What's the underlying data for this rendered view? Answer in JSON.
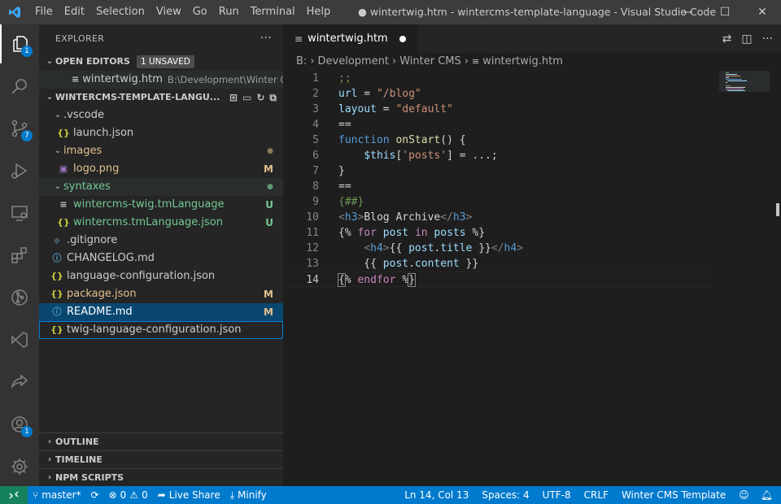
{
  "menu": [
    "File",
    "Edit",
    "Selection",
    "View",
    "Go",
    "Run",
    "Terminal",
    "Help"
  ],
  "window_title": "● wintertwig.htm - wintercms-template-language - Visual Studio Code",
  "activity_badges": {
    "explorer": "1",
    "scm": "7",
    "accounts": "1"
  },
  "sidebar": {
    "title": "EXPLORER",
    "open_editors": {
      "label": "OPEN EDITORS",
      "unsaved_badge": "1 UNSAVED",
      "items": [
        {
          "name": "wintertwig.htm",
          "path": "B:\\Development\\Winter C..."
        }
      ]
    },
    "workspace": {
      "label": "WINTERCMS-TEMPLATE-LANGU...",
      "rows": [
        {
          "label": ".vscode",
          "icon": "",
          "dec": ""
        },
        {
          "label": "launch.json",
          "icon": "{}",
          "dec": ""
        },
        {
          "label": "images",
          "icon": "",
          "dec": "●"
        },
        {
          "label": "logo.png",
          "icon": "▣",
          "dec": "M"
        },
        {
          "label": "syntaxes",
          "icon": "",
          "dec": "●"
        },
        {
          "label": "wintercms-twig.tmLanguage",
          "icon": "≡",
          "dec": "U"
        },
        {
          "label": "wintercms.tmLanguage.json",
          "icon": "{}",
          "dec": "U"
        },
        {
          "label": ".gitignore",
          "icon": "◆",
          "dec": ""
        },
        {
          "label": "CHANGELOG.md",
          "icon": "ⓘ",
          "dec": ""
        },
        {
          "label": "language-configuration.json",
          "icon": "{}",
          "dec": ""
        },
        {
          "label": "package.json",
          "icon": "{}",
          "dec": "M"
        },
        {
          "label": "README.md",
          "icon": "ⓘ",
          "dec": "M"
        },
        {
          "label": "twig-language-configuration.json",
          "icon": "{}",
          "dec": ""
        }
      ]
    },
    "bottom_sections": [
      "OUTLINE",
      "TIMELINE",
      "NPM SCRIPTS"
    ]
  },
  "editor": {
    "tab_label": "wintertwig.htm",
    "breadcrumbs": [
      "B:",
      "Development",
      "Winter CMS",
      "wintertwig.htm"
    ],
    "line_numbers": [
      "1",
      "2",
      "3",
      "4",
      "5",
      "6",
      "7",
      "8",
      "9",
      "10",
      "11",
      "12",
      "13",
      "14"
    ]
  },
  "status": {
    "branch": "master*",
    "errors": "0",
    "warnings": "0",
    "live_share": "Live Share",
    "minify": "Minify",
    "position": "Ln 14, Col 13",
    "spaces": "Spaces: 4",
    "encoding": "UTF-8",
    "eol": "CRLF",
    "language": "Winter CMS Template"
  },
  "colors": {
    "accent": "#007acc",
    "modified": "#e2c08d",
    "untracked": "#73c991",
    "selection": "#094771"
  }
}
